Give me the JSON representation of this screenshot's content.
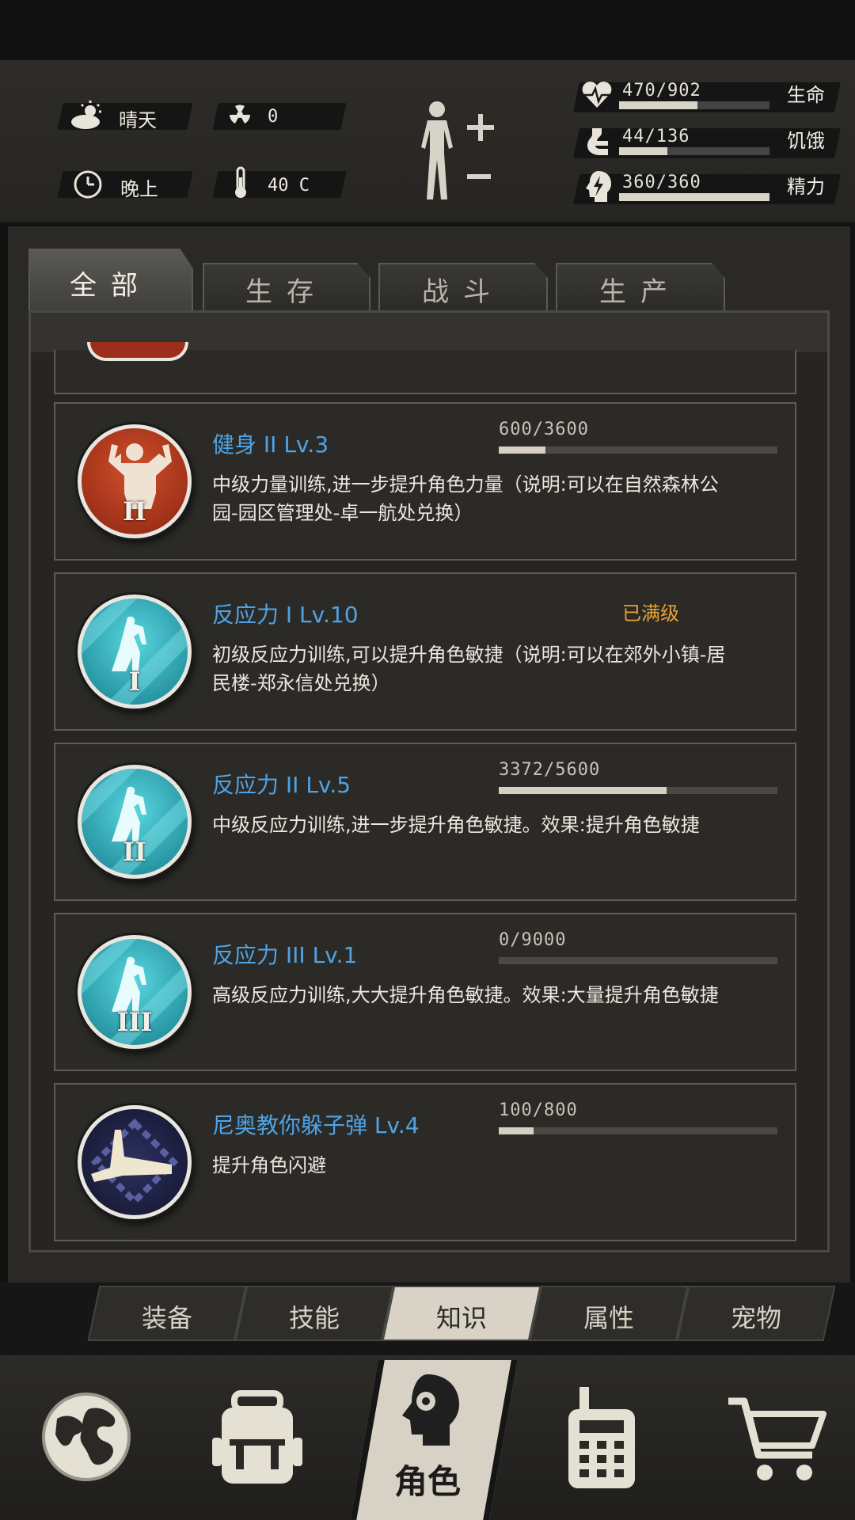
{
  "status": {
    "weather": "晴天",
    "radiation": "0",
    "time_of_day": "晚上",
    "temperature": "40 C",
    "stats": [
      {
        "label": "生命",
        "value": "470/902",
        "fraction": 0.52
      },
      {
        "label": "饥饿",
        "value": "44/136",
        "fraction": 0.32
      },
      {
        "label": "精力",
        "value": "360/360",
        "fraction": 1.0
      }
    ]
  },
  "tabs": [
    {
      "label": "全部",
      "active": true
    },
    {
      "label": "生存",
      "active": false
    },
    {
      "label": "战斗",
      "active": false
    },
    {
      "label": "生产",
      "active": false
    }
  ],
  "skills": [
    {
      "title": "健身 II Lv.3",
      "description": "中级力量训练,进一步提升角色力量（说明:可以在自然森林公园-园区管理处-卓一航处兑换）",
      "progress": "600/3600",
      "fraction": 0.1667,
      "roman": "II",
      "icon": "flex-muscle-icon",
      "max": ""
    },
    {
      "title": "反应力 I Lv.10",
      "description": "初级反应力训练,可以提升角色敏捷（说明:可以在郊外小镇-居民楼-郑永信处兑换）",
      "progress": "",
      "fraction": null,
      "roman": "I",
      "icon": "agility-icon",
      "max": "已满级"
    },
    {
      "title": "反应力 II Lv.5",
      "description": "中级反应力训练,进一步提升角色敏捷。效果:提升角色敏捷",
      "progress": "3372/5600",
      "fraction": 0.6021,
      "roman": "II",
      "icon": "agility-icon",
      "max": ""
    },
    {
      "title": "反应力 III Lv.1",
      "description": "高级反应力训练,大大提升角色敏捷。效果:大量提升角色敏捷",
      "progress": "0/9000",
      "fraction": 0.0,
      "roman": "III",
      "icon": "agility-icon",
      "max": ""
    },
    {
      "title": "尼奥教你躲子弹 Lv.4",
      "description": "提升角色闪避",
      "progress": "100/800",
      "fraction": 0.125,
      "roman": "",
      "icon": "dodge-bullet-icon",
      "max": ""
    }
  ],
  "subnav": [
    {
      "label": "装备",
      "active": false
    },
    {
      "label": "技能",
      "active": false
    },
    {
      "label": "知识",
      "active": true
    },
    {
      "label": "属性",
      "active": false
    },
    {
      "label": "宠物",
      "active": false
    }
  ],
  "bottomnav": {
    "role_label": "角色",
    "icons": [
      "globe-icon",
      "backpack-icon",
      "role-head-icon",
      "walkie-talkie-icon",
      "cart-icon"
    ]
  },
  "colors": {
    "skill_title": "#4fa3e6",
    "max_level": "#e6a23a",
    "strength_icon": "#a8331b",
    "agility_icon": "#2fb5c2",
    "dodge_icon": "#1c1e3a"
  }
}
